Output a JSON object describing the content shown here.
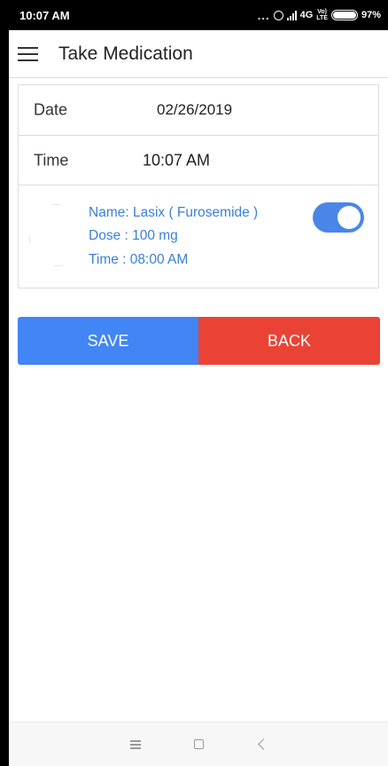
{
  "status_bar": {
    "time": "10:07 AM",
    "dots": "...",
    "network": "4G",
    "volte_top": "Vo)",
    "volte_bottom": "LTE",
    "battery": "97%"
  },
  "app_bar": {
    "title": "Take Medication",
    "menu_icon": "hamburger-icon"
  },
  "form": {
    "date_label": "Date",
    "date_value": "02/26/2019",
    "time_label": "Time",
    "time_value": "10:07 AM"
  },
  "medication": {
    "name": "Name: Lasix ( Furosemide )",
    "dose": "Dose : 100 mg",
    "time": "Time : 08:00 AM",
    "taken": true
  },
  "buttons": {
    "save_label": "SAVE",
    "back_label": "BACK"
  },
  "colors": {
    "save": "#4285f4",
    "back": "#ea4335",
    "accent_text": "#3a7fd8",
    "toggle_on": "#4a86e8"
  },
  "nav_bar": {
    "icons": [
      "recents-icon",
      "home-icon",
      "back-icon"
    ]
  }
}
